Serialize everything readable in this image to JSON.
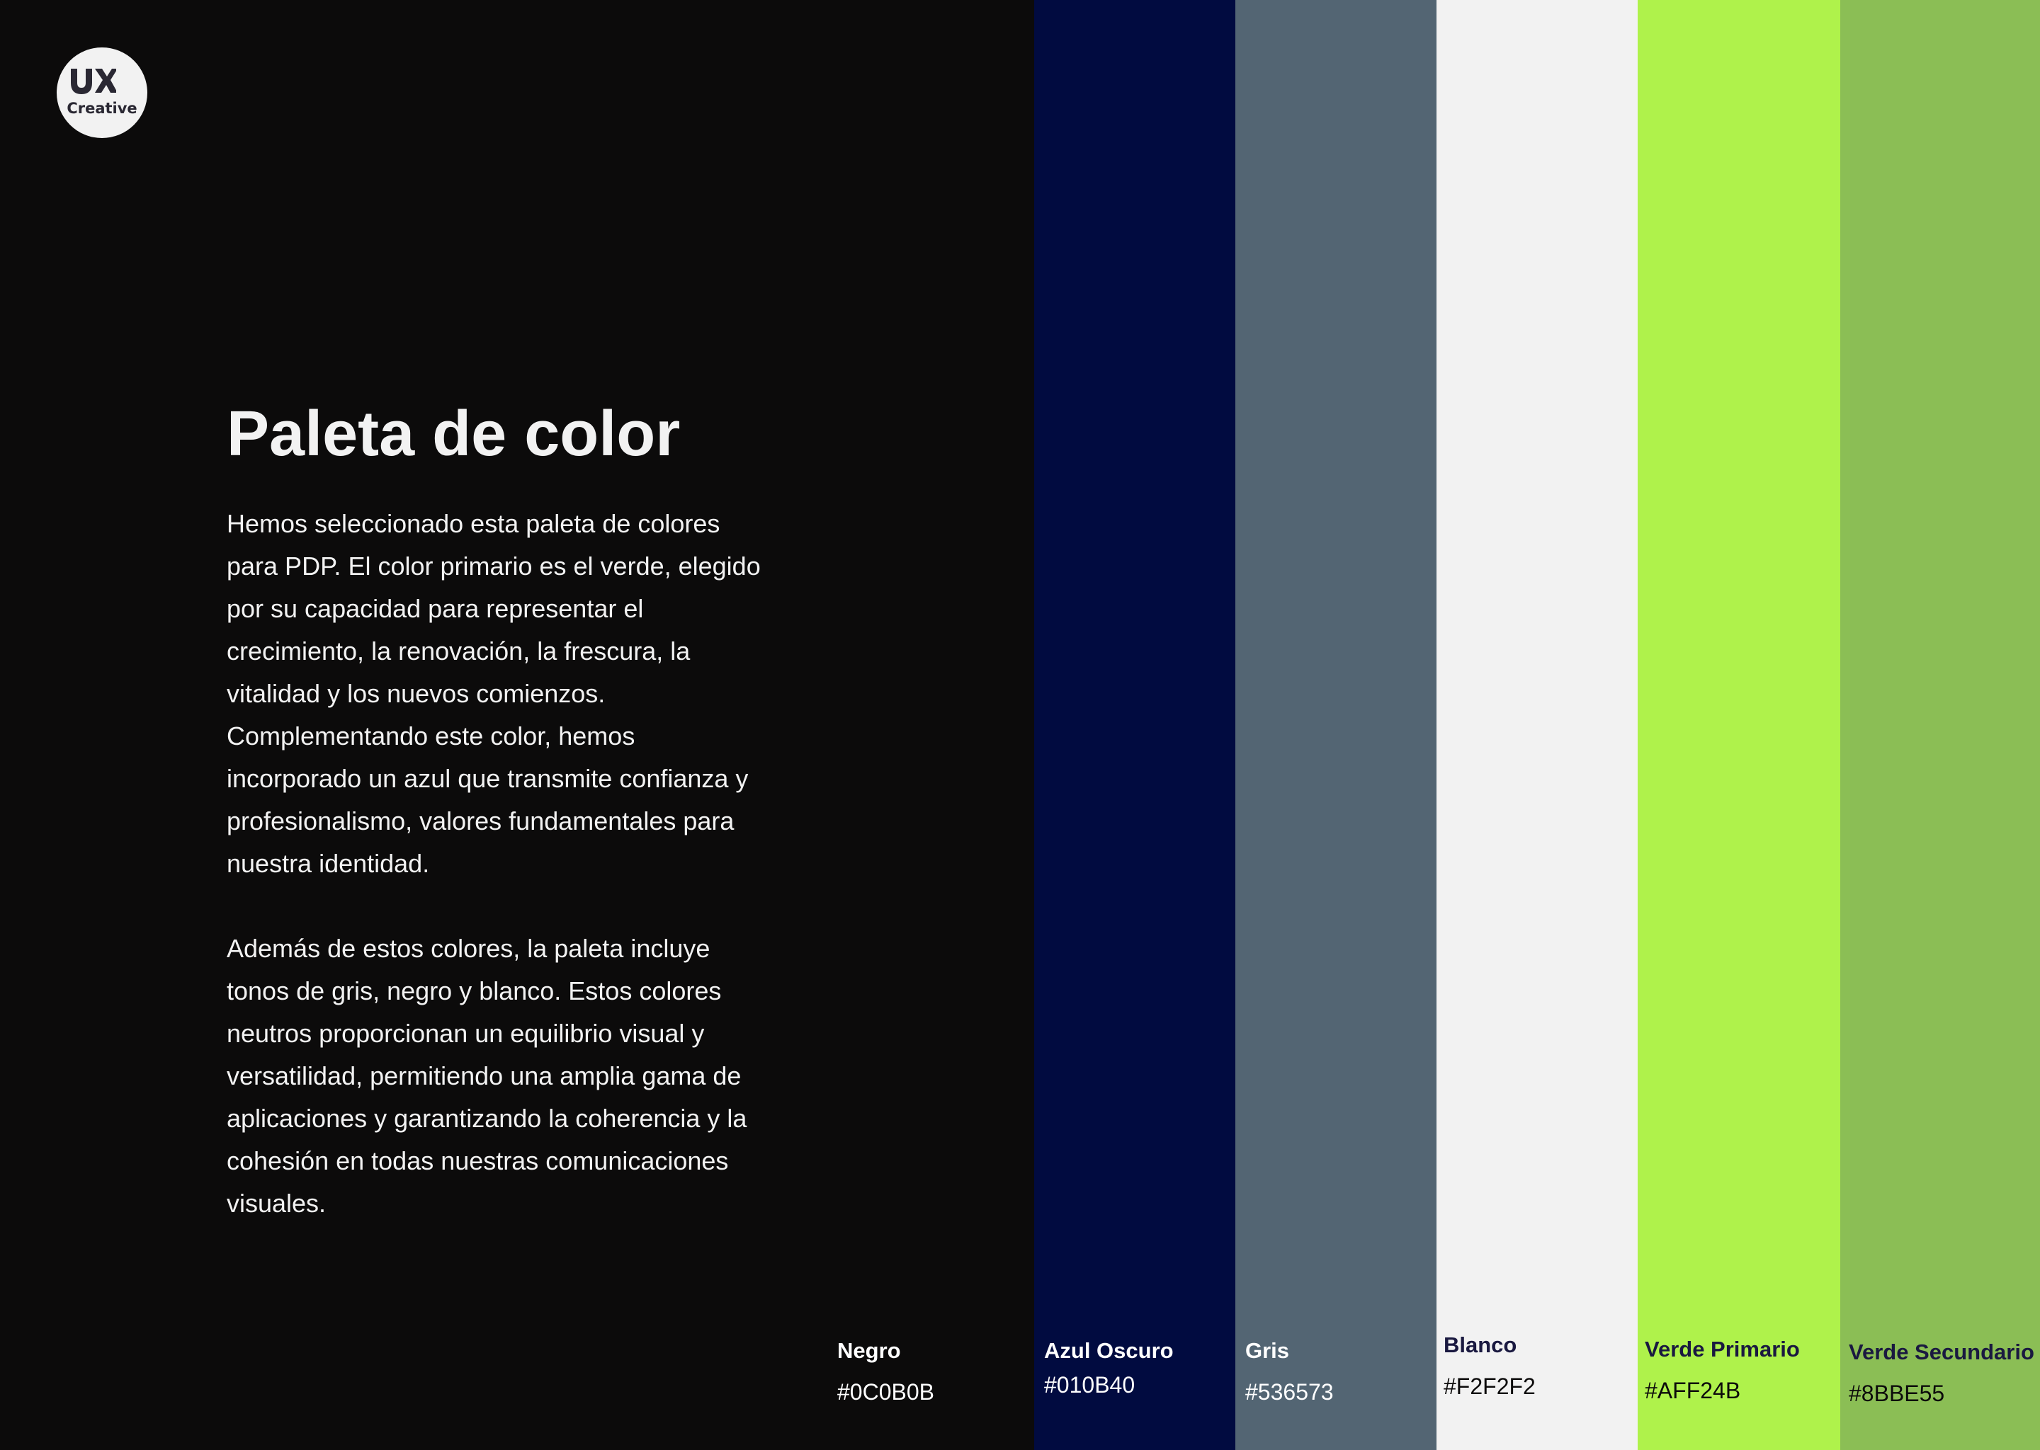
{
  "logo": {
    "mark": "UX",
    "text": "Creative"
  },
  "title": "Paleta de color",
  "paragraphs": [
    "Hemos seleccionado esta paleta de colores para PDP. El color primario es el verde, elegido por su capacidad para representar el crecimiento, la renovación, la frescura, la vitalidad y los nuevos comienzos. Complementando este color, hemos incorporado un azul que transmite confianza y profesionalismo, valores fundamentales para nuestra identidad.",
    "Además de estos colores, la paleta incluye tonos de gris, negro y blanco. Estos colores neutros proporcionan un equilibrio visual y versatilidad, permitiendo una amplia gama de aplicaciones y garantizando la coherencia y la cohesión en todas nuestras comunicaciones visuales."
  ],
  "swatches": [
    {
      "name": "Negro",
      "hex": "#0C0B0B",
      "color": "#0C0B0B",
      "text_color": "#FFFFFF"
    },
    {
      "name": "Azul Oscuro",
      "hex": "#010B40",
      "color": "#010B40",
      "text_color": "#FFFFFF"
    },
    {
      "name": "Gris",
      "hex": "#536573",
      "color": "#536573",
      "text_color": "#FFFFFF"
    },
    {
      "name": "Blanco",
      "hex": "#F2F2F2",
      "color": "#F2F2F2",
      "text_color": "#1A1940"
    },
    {
      "name": "Verde Primario",
      "hex": "#AFF24B",
      "color": "#AFF24B",
      "text_color": "#1A1940"
    },
    {
      "name": "Verde Secundario",
      "hex": "#8BBE55",
      "color": "#8BBE55",
      "text_color": "#1A1940"
    }
  ]
}
